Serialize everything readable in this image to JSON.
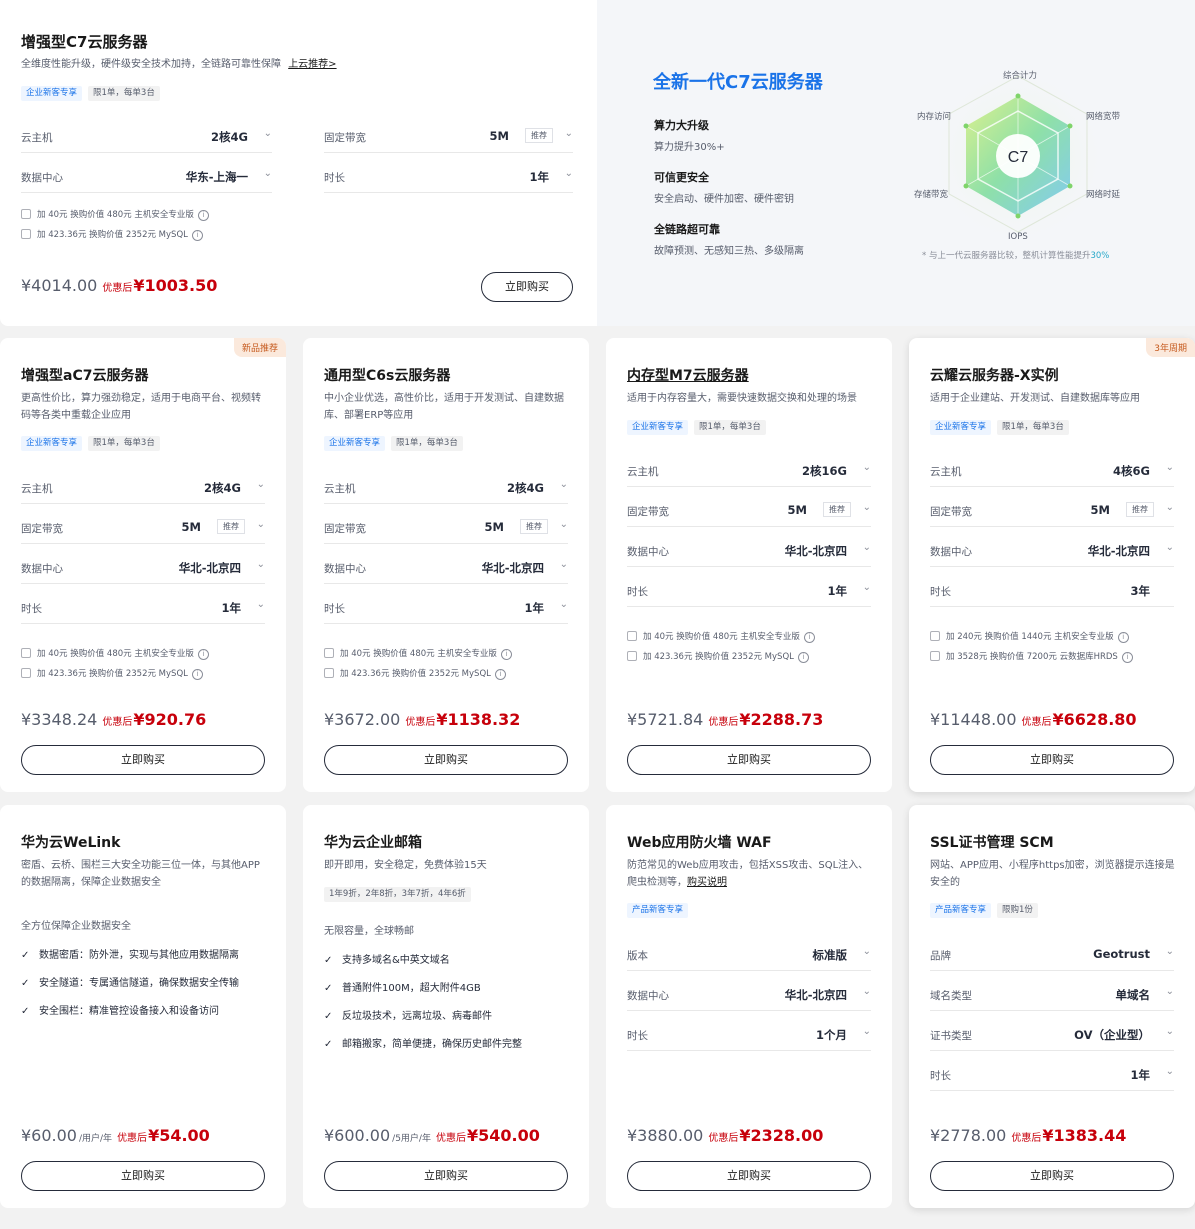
{
  "featured": {
    "title": "增强型C7云服务器",
    "desc": "全维度性能升级，硬件级安全技术加持，全链路可靠性保障",
    "desc_link": "上云推荐>",
    "tags": [
      "企业新客专享",
      "限1单，每单3台"
    ],
    "fields": {
      "cpu": {
        "label": "云主机",
        "value": "2核4G"
      },
      "bw": {
        "label": "固定带宽",
        "value": "5M",
        "rec": "推荐"
      },
      "dc": {
        "label": "数据中心",
        "value": "华东-上海一"
      },
      "dur": {
        "label": "时长",
        "value": "1年"
      }
    },
    "addons": [
      "加 40元 换购价值 480元 主机安全专业版",
      "加 423.36元 换购价值 2352元 MySQL"
    ],
    "orig_price": "¥4014.00",
    "after_label": "优惠后",
    "price": "¥1003.50",
    "buy": "立即购买"
  },
  "hero": {
    "title": "全新一代C7云服务器",
    "features": [
      {
        "t": "算力大升级",
        "d": "算力提升30%+"
      },
      {
        "t": "可信更安全",
        "d": "安全启动、硬件加密、硬件密钥"
      },
      {
        "t": "全链路超可靠",
        "d": "故障预测、无感知三热、多级隔离"
      }
    ],
    "radar_center": "C7",
    "axes": [
      "综合计力",
      "网络宽带",
      "网络时延",
      "IOPS",
      "存储带宽",
      "内存访问"
    ],
    "note": "* 与上一代云服务器比较，整机计算性能提升",
    "note_value": "30%"
  },
  "row2": [
    {
      "title": "增强型aC7云服务器",
      "corner": "新品推荐",
      "desc": "更高性价比，算力强劲稳定，适用于电商平台、视频转码等各类中重载企业应用",
      "tags": [
        "企业新客专享",
        "限1单，每单3台"
      ],
      "fields": [
        {
          "label": "云主机",
          "value": "2核4G"
        },
        {
          "label": "固定带宽",
          "value": "5M",
          "rec": "推荐"
        },
        {
          "label": "数据中心",
          "value": "华北-北京四"
        },
        {
          "label": "时长",
          "value": "1年"
        }
      ],
      "addons": [
        "加 40元 换购价值 480元 主机安全专业版",
        "加 423.36元 换购价值 2352元 MySQL"
      ],
      "orig_price": "¥3348.24",
      "after_label": "优惠后",
      "price": "¥920.76",
      "buy": "立即购买"
    },
    {
      "title": "通用型C6s云服务器",
      "desc": "中小企业优选，高性价比，适用于开发测试、自建数据库、部署ERP等应用",
      "tags": [
        "企业新客专享",
        "限1单，每单3台"
      ],
      "fields": [
        {
          "label": "云主机",
          "value": "2核4G"
        },
        {
          "label": "固定带宽",
          "value": "5M",
          "rec": "推荐"
        },
        {
          "label": "数据中心",
          "value": "华北-北京四"
        },
        {
          "label": "时长",
          "value": "1年"
        }
      ],
      "addons": [
        "加 40元 换购价值 480元 主机安全专业版",
        "加 423.36元 换购价值 2352元 MySQL"
      ],
      "orig_price": "¥3672.00",
      "after_label": "优惠后",
      "price": "¥1138.32",
      "buy": "立即购买"
    },
    {
      "title": "内存型M7云服务器",
      "desc": "适用于内存容量大，需要快速数据交换和处理的场景",
      "tags": [
        "企业新客专享",
        "限1单，每单3台"
      ],
      "fields": [
        {
          "label": "云主机",
          "value": "2核16G"
        },
        {
          "label": "固定带宽",
          "value": "5M",
          "rec": "推荐"
        },
        {
          "label": "数据中心",
          "value": "华北-北京四"
        },
        {
          "label": "时长",
          "value": "1年"
        }
      ],
      "addons": [
        "加 40元 换购价值 480元 主机安全专业版",
        "加 423.36元 换购价值 2352元 MySQL"
      ],
      "orig_price": "¥5721.84",
      "after_label": "优惠后",
      "price": "¥2288.73",
      "buy": "立即购买"
    },
    {
      "title": "云耀云服务器-X实例",
      "corner": "3年周期",
      "desc": "适用于企业建站、开发测试、自建数据库等应用",
      "tags": [
        "企业新客专享",
        "限1单，每单3台"
      ],
      "fields": [
        {
          "label": "云主机",
          "value": "4核6G"
        },
        {
          "label": "固定带宽",
          "value": "5M",
          "rec": "推荐"
        },
        {
          "label": "数据中心",
          "value": "华北-北京四"
        },
        {
          "label": "时长",
          "value": "3年"
        }
      ],
      "addons": [
        "加 240元 换购价值 1440元 主机安全专业版",
        "加 3528元 换购价值 7200元 云数据库HRDS"
      ],
      "orig_price": "¥11448.00",
      "after_label": "优惠后",
      "price": "¥6628.80",
      "buy": "立即购买"
    }
  ],
  "row3": [
    {
      "title": "华为云WeLink",
      "desc": "密盾、云桥、围栏三大安全功能三位一体，与其他APP的数据隔离，保障企业数据安全",
      "feat_head": "全方位保障企业数据安全",
      "checks": [
        "数据密盾：防外泄，实现与其他应用数据隔离",
        "安全隧道：专属通信隧道，确保数据安全传输",
        "安全围栏：精准管控设备接入和设备访问"
      ],
      "orig_price": "¥60.00",
      "unit": "/用户/年",
      "after_label": "优惠后",
      "price": "¥54.00",
      "buy": "立即购买"
    },
    {
      "title": "华为云企业邮箱",
      "desc": "即开即用，安全稳定，免费体验15天",
      "tags": [
        "1年9折，2年8折，3年7折，4年6折"
      ],
      "feat_head": "无限容量，全球畅邮",
      "checks": [
        "支持多域名&中英文域名",
        "普通附件100M，超大附件4GB",
        "反垃圾技术，远离垃圾、病毒邮件",
        "邮箱搬家，简单便捷，确保历史邮件完整"
      ],
      "orig_price": "¥600.00",
      "unit": "/5用户/年",
      "after_label": "优惠后",
      "price": "¥540.00",
      "buy": "立即购买"
    },
    {
      "title": "Web应用防火墙 WAF",
      "desc": "防范常见的Web应用攻击，包括XSS攻击、SQL注入、爬虫检测等，",
      "desc_link": "购买说明",
      "tags": [
        "产品新客专享"
      ],
      "fields": [
        {
          "label": "版本",
          "value": "标准版"
        },
        {
          "label": "数据中心",
          "value": "华北-北京四"
        },
        {
          "label": "时长",
          "value": "1个月"
        }
      ],
      "orig_price": "¥3880.00",
      "after_label": "优惠后",
      "price": "¥2328.00",
      "buy": "立即购买"
    },
    {
      "title": "SSL证书管理 SCM",
      "desc": "网站、APP应用、小程序https加密，浏览器提示连接是安全的",
      "tags": [
        "产品新客专享",
        "限购1份"
      ],
      "fields": [
        {
          "label": "品牌",
          "value": "Geotrust"
        },
        {
          "label": "域名类型",
          "value": "单域名"
        },
        {
          "label": "证书类型",
          "value": "OV（企业型）"
        },
        {
          "label": "时长",
          "value": "1年"
        }
      ],
      "orig_price": "¥2778.00",
      "after_label": "优惠后",
      "price": "¥1383.44",
      "buy": "立即购买"
    }
  ],
  "icons": {
    "chevron": "chevron-down-icon",
    "info": "info-icon",
    "check": "check-icon",
    "checkbox": "checkbox-icon"
  },
  "colors": {
    "accent": "#1a73e8",
    "price": "#c7000b",
    "corner_bg": "#fbe9dc",
    "corner_text": "#c65a1e"
  }
}
